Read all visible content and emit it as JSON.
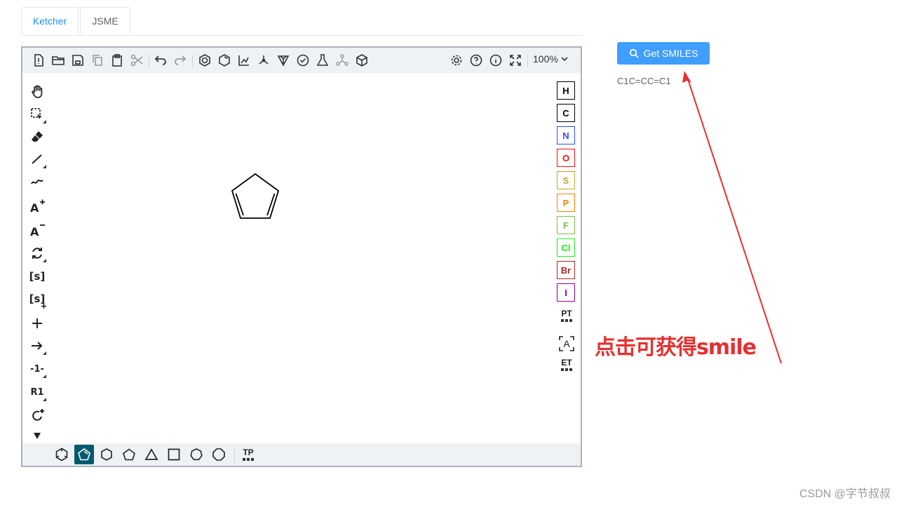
{
  "tabs": [
    {
      "label": "Ketcher",
      "active": true
    },
    {
      "label": "JSME",
      "active": false
    }
  ],
  "editor": {
    "zoom_label": "100%",
    "left_tools": [
      {
        "text": "[s]"
      },
      {
        "text": "[s]"
      },
      {
        "text": "-1-"
      },
      {
        "text": "R1"
      }
    ],
    "atoms": [
      {
        "symbol": "H",
        "color": "#000000"
      },
      {
        "symbol": "C",
        "color": "#000000"
      },
      {
        "symbol": "N",
        "color": "#3050F8"
      },
      {
        "symbol": "O",
        "color": "#FF0D0D"
      },
      {
        "symbol": "S",
        "color": "#C9A226"
      },
      {
        "symbol": "P",
        "color": "#FF8000"
      },
      {
        "symbol": "F",
        "color": "#78BE4A"
      },
      {
        "symbol": "Cl",
        "color": "#1FF01F"
      },
      {
        "symbol": "Br",
        "color": "#A62929"
      },
      {
        "symbol": "I",
        "color": "#940094"
      }
    ],
    "right_tools": {
      "periodic": "PT",
      "any_atom": "A",
      "extended": "ET"
    },
    "bottom_templates_label": "TP"
  },
  "actions": {
    "get_smiles_label": "Get SMILES",
    "smiles_result": "C1C=CC=C1"
  },
  "annotation": {
    "text": "点击可获得smile",
    "color": "#e53030"
  },
  "watermark": "CSDN @字节叔叔",
  "colors": {
    "accent": "#409eff",
    "active_tab": "#1890ff",
    "active_template": "#005a6e"
  }
}
